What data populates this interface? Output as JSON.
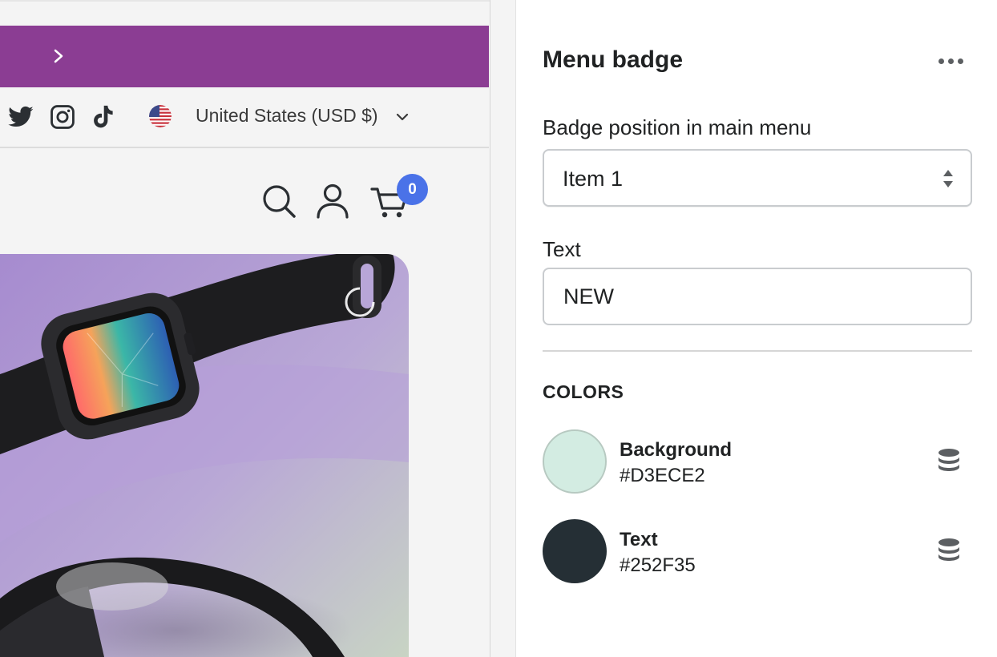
{
  "preview": {
    "country_selector": {
      "label": "United States (USD $)",
      "flag": "us-flag-icon"
    },
    "social_icons": [
      "twitter-icon",
      "instagram-icon",
      "tiktok-icon"
    ],
    "header_icons": [
      "search-icon",
      "account-icon",
      "cart-icon"
    ],
    "cart_count": "0",
    "announcement_color": "#8B3D93"
  },
  "panel": {
    "title": "Menu badge",
    "badge_position": {
      "label": "Badge position in main menu",
      "value": "Item 1"
    },
    "text_field": {
      "label": "Text",
      "value": "NEW"
    },
    "colors_heading": "COLORS",
    "colors": [
      {
        "name": "Background",
        "hex": "#D3ECE2"
      },
      {
        "name": "Text",
        "hex": "#252F35"
      }
    ]
  }
}
